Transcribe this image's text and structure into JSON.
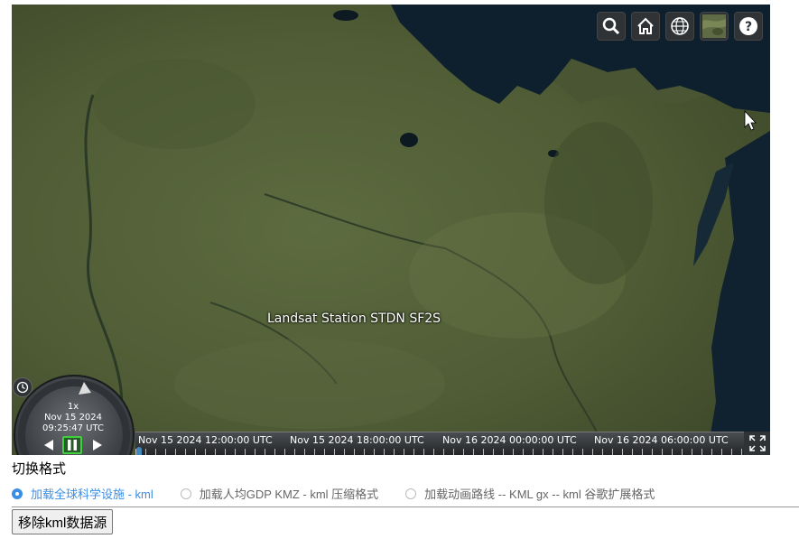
{
  "map": {
    "place_label": "Landsat Station STDN SF2S",
    "toolbar": [
      {
        "name": "search-icon"
      },
      {
        "name": "home-icon"
      },
      {
        "name": "globe-icon"
      },
      {
        "name": "imagery-picker-icon"
      },
      {
        "name": "help-icon"
      }
    ]
  },
  "animation": {
    "speed": "1x",
    "date": "Nov 15 2024",
    "time": "09:25:47 UTC"
  },
  "timeline": {
    "ticks": [
      "Nov 15 2024 12:00:00 UTC",
      "Nov 15 2024 18:00:00 UTC",
      "Nov 16 2024 00:00:00 UTC",
      "Nov 16 2024 06:00:00 UTC"
    ]
  },
  "controls": {
    "section_title": "切换格式",
    "options": [
      {
        "label": "加载全球科学设施 - kml",
        "checked": true
      },
      {
        "label": "加载人均GDP KMZ - kml 压缩格式",
        "checked": false
      },
      {
        "label": "加载动画路线 -- KML gx -- kml 谷歌扩展格式",
        "checked": false
      }
    ],
    "remove_button": "移除kml数据源"
  },
  "colors": {
    "accent": "#3a8ee6",
    "toolbar_bg": "#303336",
    "water": "#0e1f2e",
    "land": "#55623a"
  }
}
